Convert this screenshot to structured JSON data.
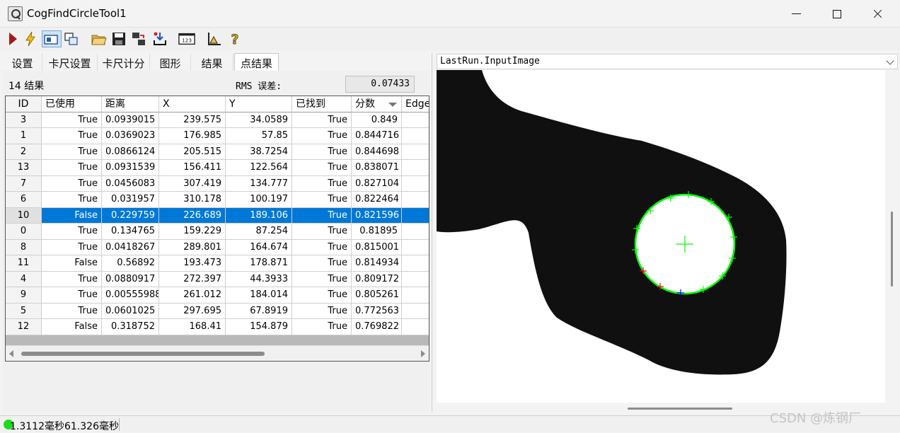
{
  "window": {
    "title": "CogFindCircleTool1"
  },
  "toolbar": {
    "buttons": [
      {
        "name": "run-icon",
        "color": "#a01818"
      },
      {
        "name": "lightning-icon",
        "color": "#f2c200"
      },
      {
        "name": "image-view-icon",
        "color": "#2a5aa0"
      },
      {
        "name": "copy-image-icon",
        "color": "#2a5aa0"
      },
      {
        "name": "open-folder-icon",
        "color": "#e2b44a"
      },
      {
        "name": "save-icon",
        "color": "#222222"
      },
      {
        "name": "settings-transfer-icon",
        "color": "#3a3a3a"
      },
      {
        "name": "import-icon",
        "color": "#1e56c2"
      },
      {
        "name": "numeric-display-icon",
        "color": "#222222"
      },
      {
        "name": "ruler-icon",
        "color": "#3a3a3a"
      },
      {
        "name": "help-icon",
        "color": "#e0a800"
      }
    ]
  },
  "tabs": [
    {
      "label": "设置",
      "active": false
    },
    {
      "label": "卡尺设置",
      "active": false
    },
    {
      "label": "卡尺计分",
      "active": false
    },
    {
      "label": "图形",
      "active": false
    },
    {
      "label": "结果",
      "active": false
    },
    {
      "label": "点结果",
      "active": true
    }
  ],
  "results": {
    "count_label": "14 结果",
    "rms_label": "RMS 误差:",
    "rms_value": "0.07433"
  },
  "table": {
    "columns": [
      "ID",
      "已使用",
      "距离",
      "X",
      "Y",
      "已找到",
      "分数",
      "Edge"
    ],
    "selected_row": 6,
    "rows": [
      [
        "3",
        "True",
        "0.0939015",
        "239.575",
        "34.0589",
        "True",
        "0.849"
      ],
      [
        "1",
        "True",
        "0.0369023",
        "176.985",
        "57.85",
        "True",
        "0.844716"
      ],
      [
        "2",
        "True",
        "0.0866124",
        "205.515",
        "38.7254",
        "True",
        "0.844698"
      ],
      [
        "13",
        "True",
        "0.0931539",
        "156.411",
        "122.564",
        "True",
        "0.838071"
      ],
      [
        "7",
        "True",
        "0.0456083",
        "307.419",
        "134.777",
        "True",
        "0.827104"
      ],
      [
        "6",
        "True",
        "0.031957",
        "310.178",
        "100.197",
        "True",
        "0.822464"
      ],
      [
        "10",
        "False",
        "0.229759",
        "226.689",
        "189.106",
        "True",
        "0.821596"
      ],
      [
        "0",
        "True",
        "0.134765",
        "159.229",
        "87.254",
        "True",
        "0.81895"
      ],
      [
        "8",
        "True",
        "0.0418267",
        "289.801",
        "164.674",
        "True",
        "0.815001"
      ],
      [
        "11",
        "False",
        "0.56892",
        "193.473",
        "178.871",
        "True",
        "0.814934"
      ],
      [
        "4",
        "True",
        "0.0880917",
        "272.397",
        "44.3933",
        "True",
        "0.809172"
      ],
      [
        "9",
        "True",
        "0.00555988",
        "261.012",
        "184.014",
        "True",
        "0.805261"
      ],
      [
        "5",
        "True",
        "0.0601025",
        "297.695",
        "67.8919",
        "True",
        "0.772563"
      ],
      [
        "12",
        "False",
        "0.318752",
        "168.41",
        "154.879",
        "True",
        "0.769822"
      ]
    ]
  },
  "image_view": {
    "selector": "LastRun.InputImage",
    "colors": {
      "part": "#101010",
      "circle": "#00ff00",
      "rejected": "#ff0000",
      "outlier": "#0000ff"
    }
  },
  "status": {
    "indicator_color": "#1ddc1d",
    "text": "1.3112毫秒61.326毫秒"
  },
  "watermark": "CSDN @炼钢厂"
}
